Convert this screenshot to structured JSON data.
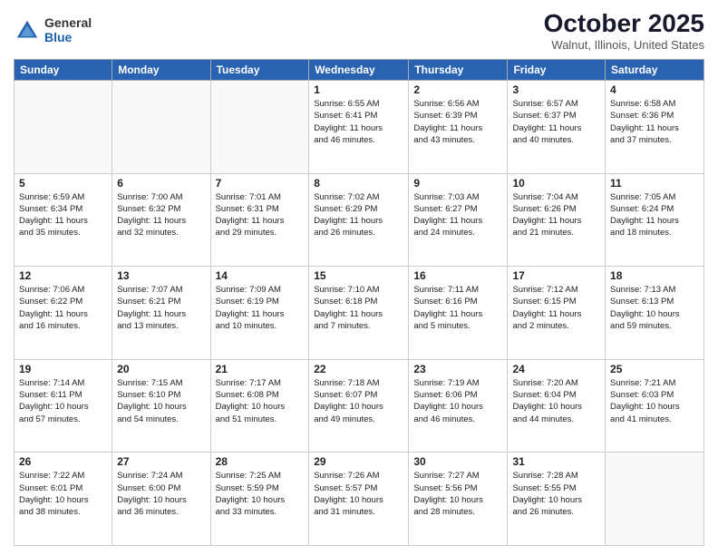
{
  "header": {
    "logo_general": "General",
    "logo_blue": "Blue",
    "month": "October 2025",
    "location": "Walnut, Illinois, United States"
  },
  "days_of_week": [
    "Sunday",
    "Monday",
    "Tuesday",
    "Wednesday",
    "Thursday",
    "Friday",
    "Saturday"
  ],
  "weeks": [
    [
      {
        "day": "",
        "info": ""
      },
      {
        "day": "",
        "info": ""
      },
      {
        "day": "",
        "info": ""
      },
      {
        "day": "1",
        "info": "Sunrise: 6:55 AM\nSunset: 6:41 PM\nDaylight: 11 hours\nand 46 minutes."
      },
      {
        "day": "2",
        "info": "Sunrise: 6:56 AM\nSunset: 6:39 PM\nDaylight: 11 hours\nand 43 minutes."
      },
      {
        "day": "3",
        "info": "Sunrise: 6:57 AM\nSunset: 6:37 PM\nDaylight: 11 hours\nand 40 minutes."
      },
      {
        "day": "4",
        "info": "Sunrise: 6:58 AM\nSunset: 6:36 PM\nDaylight: 11 hours\nand 37 minutes."
      }
    ],
    [
      {
        "day": "5",
        "info": "Sunrise: 6:59 AM\nSunset: 6:34 PM\nDaylight: 11 hours\nand 35 minutes."
      },
      {
        "day": "6",
        "info": "Sunrise: 7:00 AM\nSunset: 6:32 PM\nDaylight: 11 hours\nand 32 minutes."
      },
      {
        "day": "7",
        "info": "Sunrise: 7:01 AM\nSunset: 6:31 PM\nDaylight: 11 hours\nand 29 minutes."
      },
      {
        "day": "8",
        "info": "Sunrise: 7:02 AM\nSunset: 6:29 PM\nDaylight: 11 hours\nand 26 minutes."
      },
      {
        "day": "9",
        "info": "Sunrise: 7:03 AM\nSunset: 6:27 PM\nDaylight: 11 hours\nand 24 minutes."
      },
      {
        "day": "10",
        "info": "Sunrise: 7:04 AM\nSunset: 6:26 PM\nDaylight: 11 hours\nand 21 minutes."
      },
      {
        "day": "11",
        "info": "Sunrise: 7:05 AM\nSunset: 6:24 PM\nDaylight: 11 hours\nand 18 minutes."
      }
    ],
    [
      {
        "day": "12",
        "info": "Sunrise: 7:06 AM\nSunset: 6:22 PM\nDaylight: 11 hours\nand 16 minutes."
      },
      {
        "day": "13",
        "info": "Sunrise: 7:07 AM\nSunset: 6:21 PM\nDaylight: 11 hours\nand 13 minutes."
      },
      {
        "day": "14",
        "info": "Sunrise: 7:09 AM\nSunset: 6:19 PM\nDaylight: 11 hours\nand 10 minutes."
      },
      {
        "day": "15",
        "info": "Sunrise: 7:10 AM\nSunset: 6:18 PM\nDaylight: 11 hours\nand 7 minutes."
      },
      {
        "day": "16",
        "info": "Sunrise: 7:11 AM\nSunset: 6:16 PM\nDaylight: 11 hours\nand 5 minutes."
      },
      {
        "day": "17",
        "info": "Sunrise: 7:12 AM\nSunset: 6:15 PM\nDaylight: 11 hours\nand 2 minutes."
      },
      {
        "day": "18",
        "info": "Sunrise: 7:13 AM\nSunset: 6:13 PM\nDaylight: 10 hours\nand 59 minutes."
      }
    ],
    [
      {
        "day": "19",
        "info": "Sunrise: 7:14 AM\nSunset: 6:11 PM\nDaylight: 10 hours\nand 57 minutes."
      },
      {
        "day": "20",
        "info": "Sunrise: 7:15 AM\nSunset: 6:10 PM\nDaylight: 10 hours\nand 54 minutes."
      },
      {
        "day": "21",
        "info": "Sunrise: 7:17 AM\nSunset: 6:08 PM\nDaylight: 10 hours\nand 51 minutes."
      },
      {
        "day": "22",
        "info": "Sunrise: 7:18 AM\nSunset: 6:07 PM\nDaylight: 10 hours\nand 49 minutes."
      },
      {
        "day": "23",
        "info": "Sunrise: 7:19 AM\nSunset: 6:06 PM\nDaylight: 10 hours\nand 46 minutes."
      },
      {
        "day": "24",
        "info": "Sunrise: 7:20 AM\nSunset: 6:04 PM\nDaylight: 10 hours\nand 44 minutes."
      },
      {
        "day": "25",
        "info": "Sunrise: 7:21 AM\nSunset: 6:03 PM\nDaylight: 10 hours\nand 41 minutes."
      }
    ],
    [
      {
        "day": "26",
        "info": "Sunrise: 7:22 AM\nSunset: 6:01 PM\nDaylight: 10 hours\nand 38 minutes."
      },
      {
        "day": "27",
        "info": "Sunrise: 7:24 AM\nSunset: 6:00 PM\nDaylight: 10 hours\nand 36 minutes."
      },
      {
        "day": "28",
        "info": "Sunrise: 7:25 AM\nSunset: 5:59 PM\nDaylight: 10 hours\nand 33 minutes."
      },
      {
        "day": "29",
        "info": "Sunrise: 7:26 AM\nSunset: 5:57 PM\nDaylight: 10 hours\nand 31 minutes."
      },
      {
        "day": "30",
        "info": "Sunrise: 7:27 AM\nSunset: 5:56 PM\nDaylight: 10 hours\nand 28 minutes."
      },
      {
        "day": "31",
        "info": "Sunrise: 7:28 AM\nSunset: 5:55 PM\nDaylight: 10 hours\nand 26 minutes."
      },
      {
        "day": "",
        "info": ""
      }
    ]
  ]
}
